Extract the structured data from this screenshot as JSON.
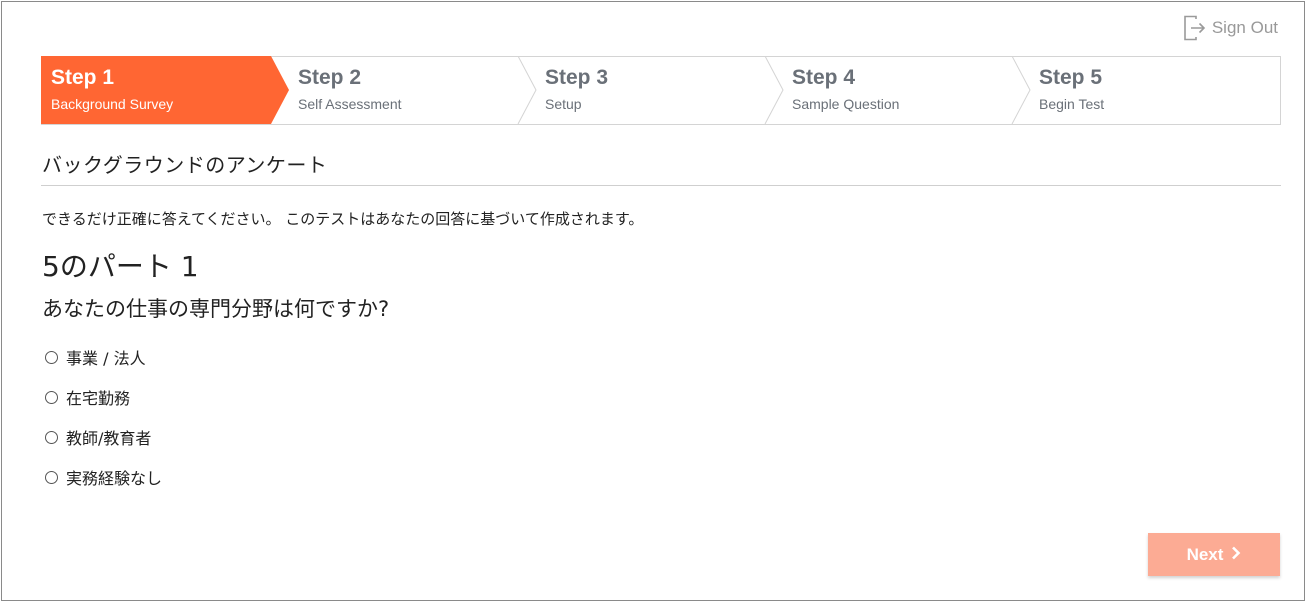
{
  "header": {
    "sign_out_label": "Sign Out"
  },
  "steps": [
    {
      "number": "Step 1",
      "label": "Background Survey",
      "active": true
    },
    {
      "number": "Step 2",
      "label": "Self Assessment",
      "active": false
    },
    {
      "number": "Step 3",
      "label": "Setup",
      "active": false
    },
    {
      "number": "Step 4",
      "label": "Sample Question",
      "active": false
    },
    {
      "number": "Step 5",
      "label": "Begin Test",
      "active": false
    }
  ],
  "survey": {
    "title": "バックグラウンドのアンケート",
    "instructions": "できるだけ正確に答えてください。 このテストはあなたの回答に基づいて作成されます。",
    "part_label": "5のパート 1",
    "question": "あなたの仕事の専門分野は何ですか?",
    "options": [
      {
        "label": "事業 / 法人"
      },
      {
        "label": "在宅勤務"
      },
      {
        "label": "教師/教育者"
      },
      {
        "label": "実務経験なし"
      }
    ]
  },
  "footer": {
    "next_label": "Next"
  },
  "colors": {
    "active_step": "#ff6633",
    "next_button": "#fcab94",
    "muted_text": "#6a7078"
  }
}
